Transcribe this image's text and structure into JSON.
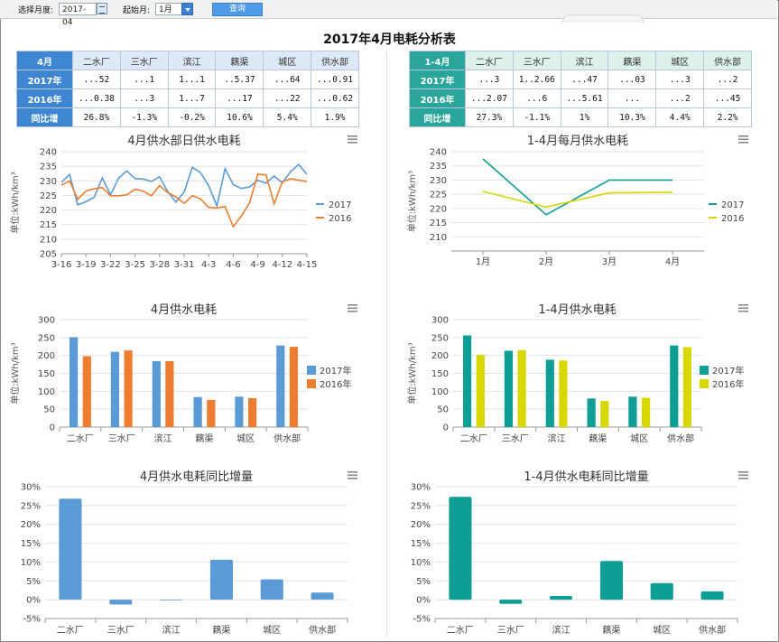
{
  "toolbar": {
    "month_label": "选择月度:",
    "month_value": "2017-04",
    "start_label": "起始月:",
    "start_value": "1月",
    "query_label": "查询"
  },
  "page_title": "2017年4月电耗分析表",
  "colors": {
    "blue": "#5b9bd5",
    "orange": "#ed7d31",
    "teal": "#0e9e96",
    "yellow": "#d8d800",
    "header_blue": "#3f86d2",
    "header_teal": "#2aa59b"
  },
  "left_table": {
    "corner": "4月",
    "columns": [
      "二水厂",
      "三水厂",
      "滨江",
      "藕渠",
      "城区",
      "供水部"
    ],
    "rows": [
      {
        "label": "2017年",
        "cells": [
          "...52",
          "...1",
          "1...1",
          "..5.37",
          "...64",
          "...0.91"
        ]
      },
      {
        "label": "2016年",
        "cells": [
          "...0.38",
          "...3",
          "1...7",
          "...17",
          "...22",
          "...0.62"
        ]
      },
      {
        "label": "同比增",
        "cells": [
          "26.8%",
          "-1.3%",
          "-0.2%",
          "10.6%",
          "5.4%",
          "1.9%"
        ]
      }
    ]
  },
  "right_table": {
    "corner": "1-4月",
    "columns": [
      "二水厂",
      "三水厂",
      "滨江",
      "藕渠",
      "城区",
      "供水部"
    ],
    "rows": [
      {
        "label": "2017年",
        "cells": [
          "...3",
          "1..2.66",
          "...47",
          "...03",
          "...3",
          "...2"
        ]
      },
      {
        "label": "2016年",
        "cells": [
          "...2.07",
          "...6",
          "...5.61",
          "...",
          "...2",
          "...45"
        ]
      },
      {
        "label": "同比增",
        "cells": [
          "27.3%",
          "-1.1%",
          "1%",
          "10.3%",
          "4.4%",
          "2.2%"
        ]
      }
    ]
  },
  "chart_data": [
    {
      "id": "c1",
      "type": "line",
      "title": "4月供水部日供水电耗",
      "ylabel": "单位:kWh/km³",
      "ylim": [
        205,
        240
      ],
      "yticks": [
        205,
        210,
        215,
        220,
        225,
        230,
        235,
        240
      ],
      "x": [
        "3-16",
        "3-17",
        "3-18",
        "3-19",
        "3-20",
        "3-21",
        "3-22",
        "3-23",
        "3-24",
        "3-25",
        "3-26",
        "3-27",
        "3-28",
        "3-29",
        "3-30",
        "3-31",
        "4-1",
        "4-2",
        "4-3",
        "4-4",
        "4-5",
        "4-6",
        "4-7",
        "4-8",
        "4-9",
        "4-10",
        "4-11",
        "4-12",
        "4-13",
        "4-14",
        "4-15"
      ],
      "xtick_labels": [
        "3-16",
        "3-19",
        "3-22",
        "3-25",
        "3-28",
        "3-31",
        "4-3",
        "4-6",
        "4-9",
        "4-12",
        "4-15"
      ],
      "legend": "right",
      "series": [
        {
          "name": "2017",
          "color": "#5b9bd5",
          "values": [
            229.5,
            232.2,
            221.8,
            222.8,
            224.4,
            231.0,
            225.2,
            231.0,
            233.4,
            230.8,
            230.6,
            229.8,
            231.4,
            226.3,
            222.7,
            226.2,
            234.6,
            232.8,
            228.3,
            221.4,
            234.2,
            228.7,
            227.4,
            227.9,
            230.2,
            229.2,
            231.6,
            229.3,
            233.2,
            235.6,
            232.3
          ]
        },
        {
          "name": "2016",
          "color": "#ed7d31",
          "values": [
            228.5,
            230.0,
            223.7,
            226.5,
            227.3,
            227.7,
            224.9,
            224.9,
            225.2,
            227.1,
            226.5,
            224.9,
            228.4,
            225.9,
            224.5,
            222.3,
            224.9,
            223.8,
            220.9,
            220.7,
            221.2,
            214.3,
            218.0,
            222.5,
            232.3,
            232.0,
            222.1,
            229.7,
            230.7,
            230.2,
            229.8
          ]
        }
      ]
    },
    {
      "id": "c2",
      "type": "line",
      "title": "1-4月每月供水电耗",
      "ylabel": "单位:kWh/km³",
      "ylim": [
        205,
        240
      ],
      "yticks": [
        210,
        215,
        220,
        225,
        230,
        235,
        240
      ],
      "x": [
        "1月",
        "2月",
        "3月",
        "4月"
      ],
      "xtick_labels": [
        "1月",
        "2月",
        "3月",
        "4月"
      ],
      "legend": "right",
      "series": [
        {
          "name": "2017",
          "color": "#0e9e96",
          "values": [
            237.5,
            217.8,
            230.0,
            230.0
          ]
        },
        {
          "name": "2016",
          "color": "#d8d800",
          "values": [
            226.0,
            220.5,
            225.5,
            225.7
          ]
        }
      ]
    },
    {
      "id": "c3",
      "type": "bar",
      "title": "4月供水电耗",
      "ylabel": "单位:kWh/km³",
      "ylim": [
        0,
        300
      ],
      "yticks": [
        0,
        50,
        100,
        150,
        200,
        250,
        300
      ],
      "categories": [
        "二水厂",
        "三水厂",
        "滨江",
        "藕渠",
        "城区",
        "供水部"
      ],
      "legend": "right",
      "series": [
        {
          "name": "2017年",
          "color": "#5b9bd5",
          "values": [
            251,
            210,
            184,
            84,
            85,
            228
          ]
        },
        {
          "name": "2016年",
          "color": "#ed7d31",
          "values": [
            198,
            214,
            184,
            76,
            81,
            224
          ]
        }
      ]
    },
    {
      "id": "c4",
      "type": "bar",
      "title": "1-4月供水电耗",
      "ylabel": "单位:kWh/km³",
      "ylim": [
        0,
        300
      ],
      "yticks": [
        0,
        50,
        100,
        150,
        200,
        250,
        300
      ],
      "categories": [
        "二水厂",
        "三水厂",
        "滨江",
        "藕渠",
        "城区",
        "供水部"
      ],
      "legend": "right",
      "series": [
        {
          "name": "2017年",
          "color": "#0e9e96",
          "values": [
            256,
            213,
            188,
            80,
            85,
            228
          ]
        },
        {
          "name": "2016年",
          "color": "#d8d800",
          "values": [
            202,
            215,
            186,
            73,
            82,
            223
          ]
        }
      ]
    },
    {
      "id": "c5",
      "type": "bar",
      "title": "4月供水电耗同比增量",
      "ylim": [
        -5,
        30
      ],
      "yticks": [
        -5,
        0,
        5,
        10,
        15,
        20,
        25,
        30
      ],
      "ytick_suffix": "%",
      "categories": [
        "二水厂",
        "三水厂",
        "滨江",
        "藕渠",
        "城区",
        "供水部"
      ],
      "series": [
        {
          "color": "#5b9bd5",
          "values": [
            26.8,
            -1.3,
            -0.2,
            10.6,
            5.4,
            1.9
          ]
        }
      ]
    },
    {
      "id": "c6",
      "type": "bar",
      "title": "1-4月供水电耗同比增量",
      "ylim": [
        -5,
        30
      ],
      "yticks": [
        -5,
        0,
        5,
        10,
        15,
        20,
        25,
        30
      ],
      "ytick_suffix": "%",
      "categories": [
        "二水厂",
        "三水厂",
        "滨江",
        "藕渠",
        "城区",
        "供水部"
      ],
      "series": [
        {
          "color": "#0e9e96",
          "values": [
            27.3,
            -1.1,
            1.0,
            10.3,
            4.4,
            2.2
          ]
        }
      ]
    }
  ]
}
